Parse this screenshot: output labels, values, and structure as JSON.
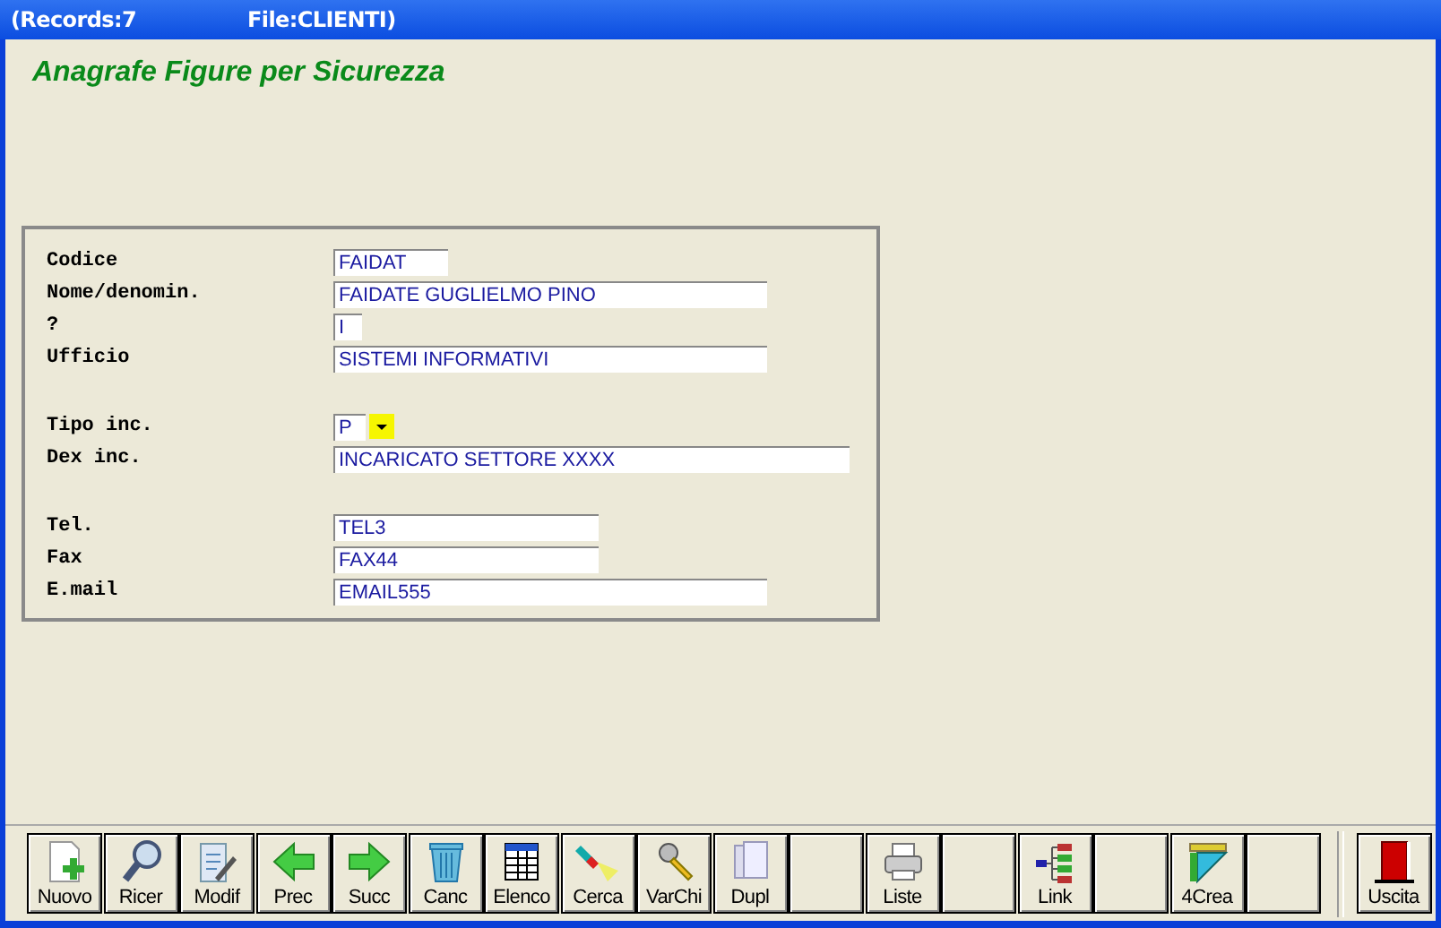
{
  "window": {
    "title_records": "(Records:7",
    "title_file": "File:CLIENTI)"
  },
  "heading": "Anagrafe Figure per Sicurezza",
  "form_groups": [
    [
      {
        "label": "Codice",
        "value": "FAIDAT",
        "kind": "text"
      },
      {
        "label": "Nome/denomin.",
        "value": "FAIDATE GUGLIELMO PINO",
        "kind": "text"
      },
      {
        "label": "?",
        "value": "I",
        "kind": "text"
      },
      {
        "label": "Ufficio",
        "value": "SISTEMI INFORMATIVI",
        "kind": "text"
      }
    ],
    [
      {
        "label": "Tipo inc.",
        "value": "P",
        "kind": "select"
      },
      {
        "label": "Dex inc.",
        "value": "INCARICATO SETTORE XXXX",
        "kind": "text"
      }
    ],
    [
      {
        "label": "Tel.",
        "value": "TEL3",
        "kind": "text"
      },
      {
        "label": "Fax",
        "value": "FAX44",
        "kind": "text"
      },
      {
        "label": "E.mail",
        "value": "EMAIL555",
        "kind": "text"
      }
    ]
  ],
  "toolbar": [
    {
      "kind": "action",
      "label": "Nuovo"
    },
    {
      "kind": "action",
      "label": "Ricer"
    },
    {
      "kind": "action",
      "label": "Modif"
    },
    {
      "kind": "action",
      "label": "Prec"
    },
    {
      "kind": "action",
      "label": "Succ"
    },
    {
      "kind": "action",
      "label": "Canc"
    },
    {
      "kind": "action",
      "label": "Elenco"
    },
    {
      "kind": "action",
      "label": "Cerca"
    },
    {
      "kind": "action",
      "label": "VarChi"
    },
    {
      "kind": "action",
      "label": "Dupl"
    },
    {
      "kind": "blank"
    },
    {
      "kind": "action",
      "label": "Liste"
    },
    {
      "kind": "blank"
    },
    {
      "kind": "action",
      "label": "Link"
    },
    {
      "kind": "blank"
    },
    {
      "kind": "action",
      "label": "4Crea"
    },
    {
      "kind": "blank"
    },
    {
      "kind": "exit",
      "label": "Uscita"
    }
  ]
}
